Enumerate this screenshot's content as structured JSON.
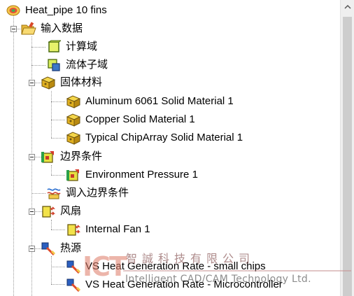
{
  "tree": {
    "root": {
      "label": "Heat_pipe 10 fins",
      "icon": "project-icon"
    },
    "input_data": {
      "label": "输入数据",
      "icon": "open-folder-icon"
    },
    "computational_domain": {
      "label": "计算域",
      "icon": "domain-cube-icon"
    },
    "fluid_subdomain": {
      "label": "流体子域",
      "icon": "fluid-subdomain-icon"
    },
    "solid_materials": {
      "label": "固体材料",
      "icon": "solid-material-icon",
      "items": [
        {
          "label": "Aluminum 6061 Solid Material 1"
        },
        {
          "label": "Copper Solid Material 1"
        },
        {
          "label": "Typical ChipArray Solid Material 1"
        }
      ]
    },
    "boundary_conditions": {
      "label": "边界条件",
      "icon": "boundary-condition-icon",
      "items": [
        {
          "label": "Environment Pressure 1"
        }
      ]
    },
    "imported_boundary_conditions": {
      "label": "调入边界条件",
      "icon": "import-boundary-icon"
    },
    "fans": {
      "label": "风扇",
      "icon": "fan-icon",
      "items": [
        {
          "label": "Internal Fan 1"
        }
      ]
    },
    "heat_sources": {
      "label": "热源",
      "icon": "heat-source-icon",
      "items": [
        {
          "label": "VS Heat Generation Rate - small chips"
        },
        {
          "label": "VS Heat Generation Rate - Microcontroller"
        }
      ]
    }
  },
  "watermark": {
    "logo": "ICT",
    "company_cn": "智誠科技有限公司",
    "company_en": "Intelligent CAD/CAM Technology Ltd."
  },
  "colors": {
    "background": "#ffffff",
    "tree_line": "#9a9a9a",
    "scrollbar_track": "#cdcdcd"
  }
}
